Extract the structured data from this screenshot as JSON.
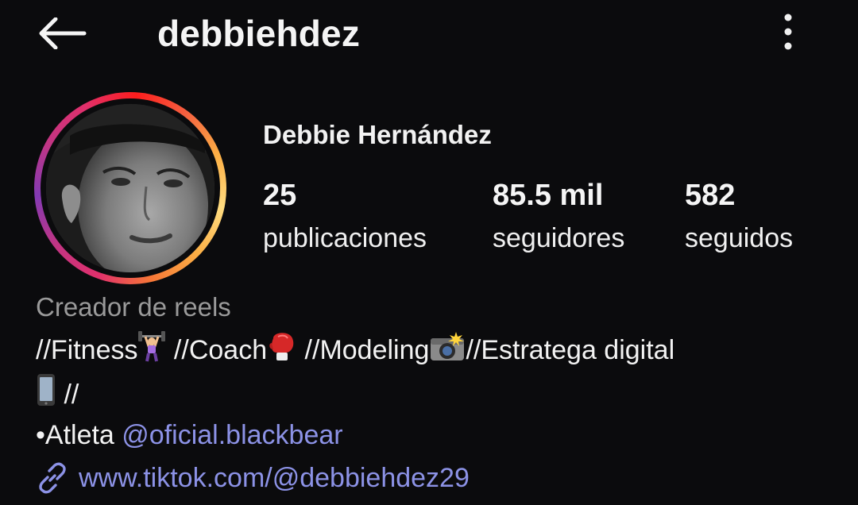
{
  "header": {
    "username": "debbiehdez",
    "back_icon": "arrow-left-icon",
    "more_icon": "more-vertical-icon"
  },
  "profile": {
    "display_name": "Debbie Hernández",
    "stats": [
      {
        "value": "25",
        "label": "publicaciones"
      },
      {
        "value": "85.5 mil",
        "label": "seguidores"
      },
      {
        "value": "582",
        "label": "seguidos"
      }
    ]
  },
  "bio": {
    "category": "Creador de reels",
    "line1": {
      "p1": "//Fitness",
      "p2": " //Coach",
      "p3": " //Modeling",
      "p4": "//Estratega digital"
    },
    "line2": " //",
    "line3": {
      "prefix": "•Atleta ",
      "mention": "@oficial.blackbear"
    },
    "link": "www.tiktok.com/@debbiehdez29"
  },
  "colors": {
    "background": "#0b0b0d",
    "link": "#8c92e6",
    "muted": "#9a9a9a"
  }
}
